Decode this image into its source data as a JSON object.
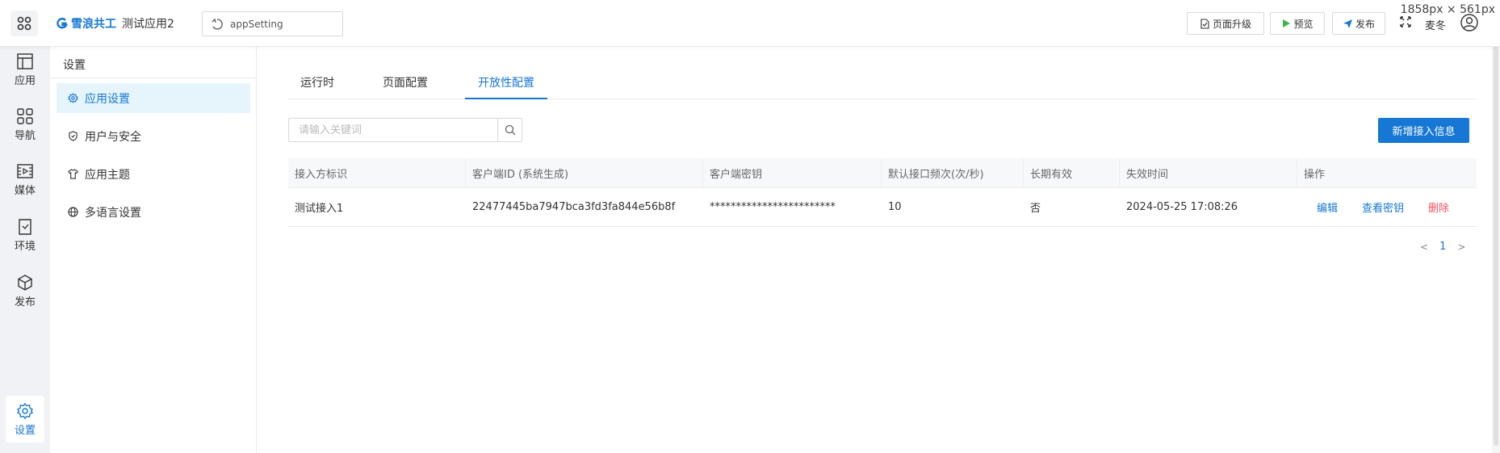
{
  "screen_size_label": "1858px × 561px",
  "header": {
    "brand": "雪浪共工",
    "app_name": "测试应用2",
    "selector_value": "appSetting",
    "upgrade_label": "页面升级",
    "preview_label": "预览",
    "publish_label": "发布",
    "user_name": "麦冬"
  },
  "rail": {
    "items": [
      {
        "label": "应用",
        "icon": "layout-icon"
      },
      {
        "label": "导航",
        "icon": "grid-icon"
      },
      {
        "label": "媒体",
        "icon": "media-icon"
      },
      {
        "label": "环境",
        "icon": "environment-icon"
      },
      {
        "label": "发布",
        "icon": "cube-icon"
      }
    ],
    "settings_label": "设置"
  },
  "subnav": {
    "title": "设置",
    "items": [
      {
        "label": "应用设置",
        "icon": "gear-icon",
        "active": true
      },
      {
        "label": "用户与安全",
        "icon": "shield-icon",
        "active": false
      },
      {
        "label": "应用主题",
        "icon": "shirt-icon",
        "active": false
      },
      {
        "label": "多语言设置",
        "icon": "globe-icon",
        "active": false
      }
    ]
  },
  "tabs": [
    {
      "label": "运行时",
      "active": false
    },
    {
      "label": "页面配置",
      "active": false
    },
    {
      "label": "开放性配置",
      "active": true
    }
  ],
  "search": {
    "placeholder": "请输入关键词",
    "value": ""
  },
  "add_button_label": "新增接入信息",
  "table": {
    "columns": [
      "接入方标识",
      "客户端ID (系统生成)",
      "客户端密钥",
      "默认接口频次(次/秒)",
      "长期有效",
      "失效时间",
      "操作"
    ],
    "rows": [
      {
        "identifier": "测试接入1",
        "client_id": "22477445ba7947bca3fd3fa844e56b8f",
        "secret": "************************",
        "rate": "10",
        "long_term": "否",
        "expire": "2024-05-25 17:08:26",
        "actions": {
          "edit": "编辑",
          "view_secret": "查看密钥",
          "delete": "删除"
        }
      }
    ]
  },
  "pagination": {
    "current_page": "1",
    "prev": "<",
    "next": ">"
  },
  "colors": {
    "accent": "#1677d4",
    "danger": "#f5535f",
    "rail_bg": "#f0f2f5",
    "active_bg": "#e6f4fc"
  }
}
